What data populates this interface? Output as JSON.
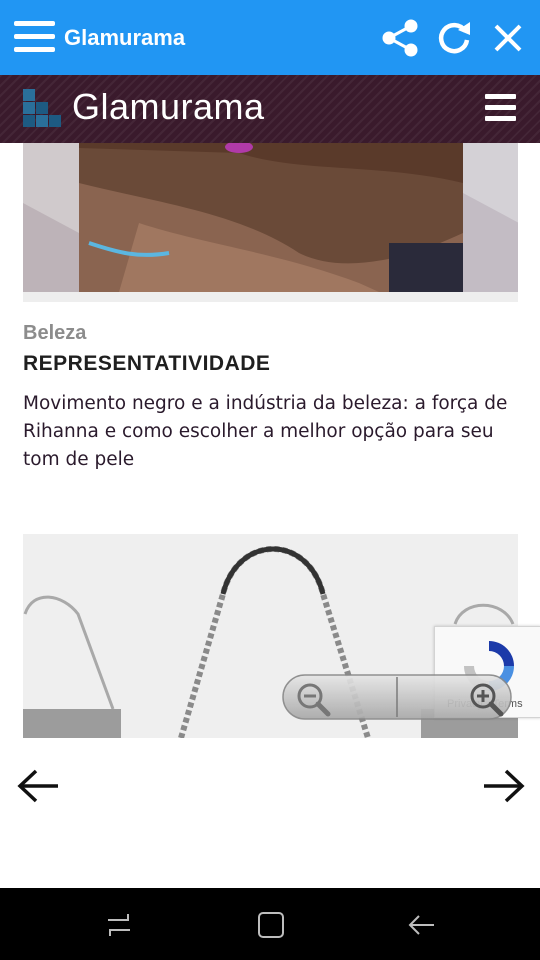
{
  "app_bar": {
    "title": "Glamurama",
    "icons": [
      "menu-icon",
      "share-icon",
      "refresh-icon",
      "close-icon"
    ]
  },
  "site_header": {
    "brand": "Glamurama",
    "icons": [
      "glamurama-logo",
      "hamburger-menu-icon"
    ]
  },
  "article": {
    "category": "Beleza",
    "kicker": "REPRESENTATIVIDADE",
    "headline": "Movimento negro e a indústria da beleza: a força de Rihanna e como escolher a melhor opção para seu tom de pele"
  },
  "recaptcha": {
    "links": "Privacy - Terms"
  },
  "zoom_controls": {
    "icons": [
      "zoom-out-icon",
      "zoom-in-icon"
    ]
  },
  "pager": {
    "icons": [
      "arrow-left-icon",
      "arrow-right-icon"
    ]
  },
  "system_nav": {
    "icons": [
      "recents-icon",
      "home-icon",
      "back-icon"
    ]
  },
  "colors": {
    "app_bar": "#2196f3",
    "site_header": "#3a1a2c",
    "headline_text": "#2a1a2c",
    "category_text": "#8c8c8c"
  }
}
